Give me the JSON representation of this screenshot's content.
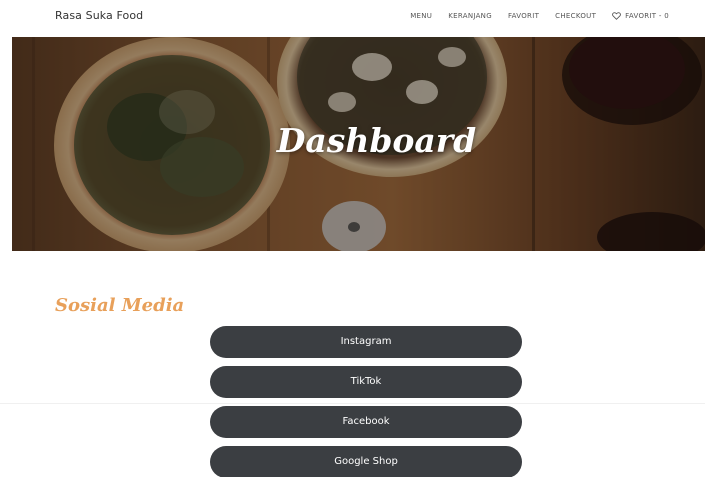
{
  "navbar": {
    "brand": "Rasa Suka Food",
    "links": [
      {
        "label": "MENU"
      },
      {
        "label": "KERANJANG"
      },
      {
        "label": "FAVORIT"
      },
      {
        "label": "CHECKOUT"
      },
      {
        "label": "FAVORIT - 0",
        "icon": "heart-icon"
      }
    ]
  },
  "hero": {
    "title": "Dashboard"
  },
  "social": {
    "heading": "Sosial Media",
    "buttons": [
      {
        "label": "Instagram"
      },
      {
        "label": "TikTok"
      },
      {
        "label": "Facebook"
      },
      {
        "label": "Google Shop"
      }
    ]
  },
  "colors": {
    "accent": "#e8a05a",
    "button": "#3b3e42"
  }
}
